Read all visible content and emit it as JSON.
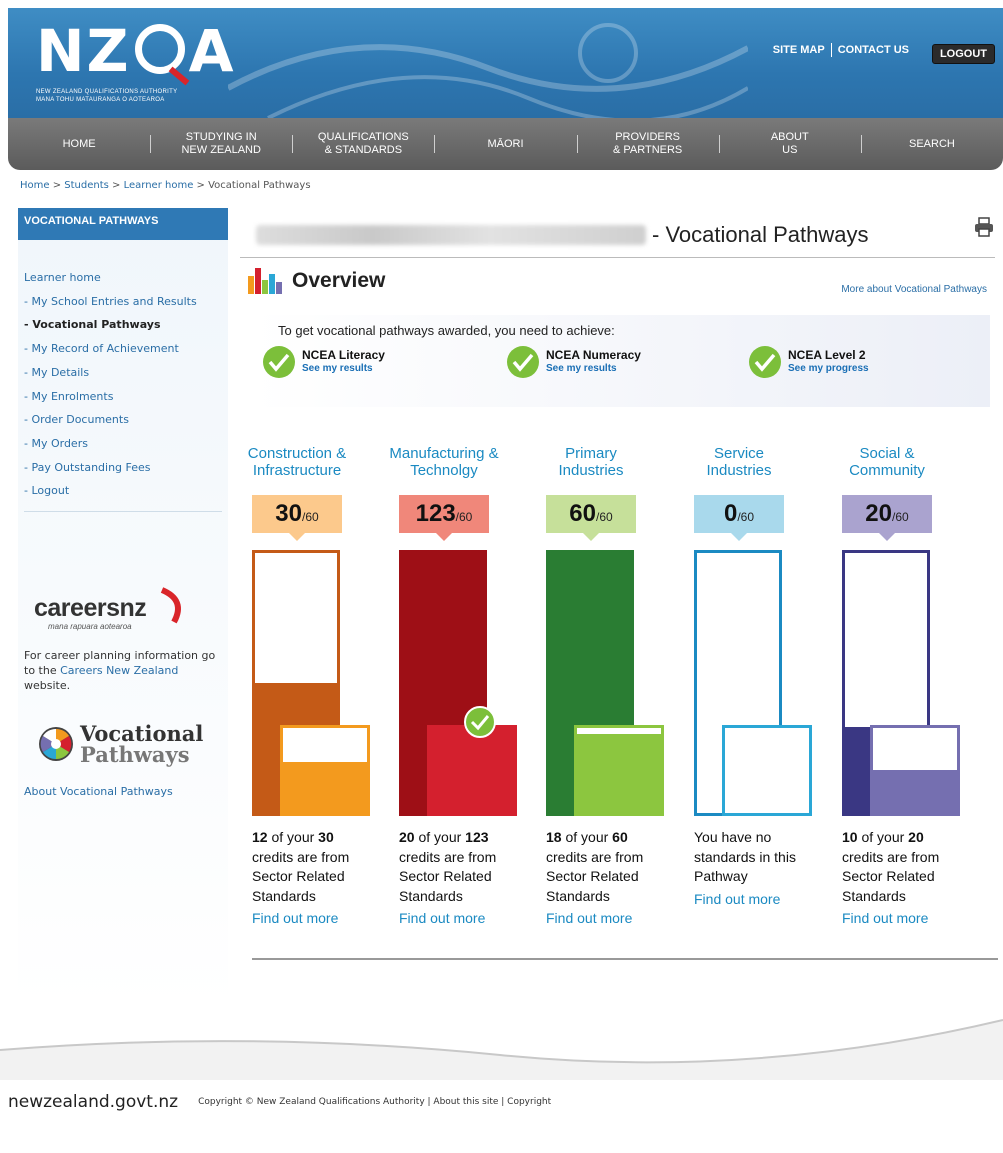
{
  "header": {
    "logo_text": "NZQA",
    "logo_sub1": "NEW ZEALAND QUALIFICATIONS AUTHORITY",
    "logo_sub2": "MANA TOHU MATAURANGA O AOTEAROA",
    "site_map": "SITE MAP",
    "contact_us": "CONTACT US",
    "logout": "LOGOUT"
  },
  "nav": [
    {
      "label": "HOME"
    },
    {
      "label": "STUDYING IN\nNEW ZEALAND"
    },
    {
      "label": "QUALIFICATIONS\n& STANDARDS"
    },
    {
      "label": "MĀORI"
    },
    {
      "label": "PROVIDERS\n& PARTNERS"
    },
    {
      "label": "ABOUT\nUS"
    },
    {
      "label": "SEARCH"
    }
  ],
  "breadcrumb": {
    "home": "Home",
    "students": "Students",
    "learner_home": "Learner home",
    "current": "Vocational Pathways",
    "sep": " > "
  },
  "sidebar": {
    "heading": "VOCATIONAL PATHWAYS",
    "links": [
      {
        "label": "Learner home",
        "active": false
      },
      {
        "label": "- My School Entries and Results",
        "active": false
      },
      {
        "label": "- Vocational Pathways",
        "active": true
      },
      {
        "label": "- My Record of Achievement",
        "active": false
      },
      {
        "label": "- My Details",
        "active": false
      },
      {
        "label": "- My Enrolments",
        "active": false
      },
      {
        "label": "- Order Documents",
        "active": false
      },
      {
        "label": "- My Orders",
        "active": false
      },
      {
        "label": "- Pay Outstanding Fees",
        "active": false
      },
      {
        "label": "- Logout",
        "active": false
      }
    ],
    "careers_logo_word": "careersnz",
    "careers_logo_maori": "mana rapuara aotearoa",
    "careers_text_before": "For career planning information go to the ",
    "careers_link": "Careers New Zealand",
    "careers_text_after": " website.",
    "vp_logo_line1": "Vocational",
    "vp_logo_line2": "Pathways",
    "about_vp": "About Vocational Pathways"
  },
  "main": {
    "title_suffix": "- Vocational Pathways",
    "overview": "Overview",
    "more_about": "More about Vocational Pathways",
    "requirements_label": "To get vocational pathways awarded, you need to achieve:",
    "requirements": [
      {
        "title": "NCEA Literacy",
        "link": "See my results"
      },
      {
        "title": "NCEA Numeracy",
        "link": "See my results"
      },
      {
        "title": "NCEA Level 2",
        "link": "See my progress"
      }
    ]
  },
  "pathways": [
    {
      "title_line1": "Construction &",
      "title_line2": "Infrastructure",
      "credits": "30",
      "out_of": "/60",
      "score_bg": "#fcc98c",
      "outer_color": "#c45a17",
      "inner_border": "#f39a1e",
      "inner_fill": "#f39a1e",
      "outer_fill_fraction": 0.5,
      "inner_fill_fraction": 0.6,
      "achieved": false,
      "sector_credits": "12",
      "desc_mid": " of your ",
      "desc_end": " credits are from Sector Related Standards",
      "find_out": "Find out more"
    },
    {
      "title_line1": "Manufacturing &",
      "title_line2": "Technolgy",
      "credits": "123",
      "out_of": "/60",
      "score_bg": "#f0877a",
      "outer_color": "#9e0f16",
      "inner_border": "#d4202e",
      "inner_fill": "#d4202e",
      "outer_fill_fraction": 1.0,
      "inner_fill_fraction": 1.0,
      "achieved": true,
      "sector_credits": "20",
      "desc_mid": " of your ",
      "desc_end": " credits are from Sector Related Standards",
      "find_out": "Find out more"
    },
    {
      "title_line1": "Primary",
      "title_line2": "Industries",
      "credits": "60",
      "out_of": "/60",
      "score_bg": "#c6e09a",
      "outer_color": "#2a7d33",
      "inner_border": "#8cc63f",
      "inner_fill": "#8cc63f",
      "outer_fill_fraction": 1.0,
      "inner_fill_fraction": 0.93,
      "achieved": false,
      "sector_credits": "18",
      "desc_mid": " of your ",
      "desc_end": " credits are from Sector Related Standards",
      "find_out": "Find out more"
    },
    {
      "title_line1": "Service",
      "title_line2": "Industries",
      "credits": "0",
      "out_of": "/60",
      "score_bg": "#a9d9ec",
      "outer_color": "#1b8ac2",
      "inner_border": "#2aa7d6",
      "inner_fill": "#2aa7d6",
      "outer_fill_fraction": 0.0,
      "inner_fill_fraction": 0.0,
      "achieved": false,
      "no_standards": "You have no standards in this Pathway",
      "find_out": "Find out more"
    },
    {
      "title_line1": "Social &",
      "title_line2": "Community",
      "credits": "20",
      "out_of": "/60",
      "score_bg": "#aaa3cf",
      "outer_color": "#3a3783",
      "inner_border": "#756fb0",
      "inner_fill": "#756fb0",
      "outer_fill_fraction": 0.33,
      "inner_fill_fraction": 0.5,
      "achieved": false,
      "sector_credits": "10",
      "desc_mid": " of your ",
      "desc_end": " credits are from Sector Related Standards",
      "find_out": "Find out more"
    }
  ],
  "footer": {
    "govt": "newzealand.govt.nz",
    "copyright": "Copyright © New Zealand Qualifications Authority | About this site | Copyright"
  }
}
